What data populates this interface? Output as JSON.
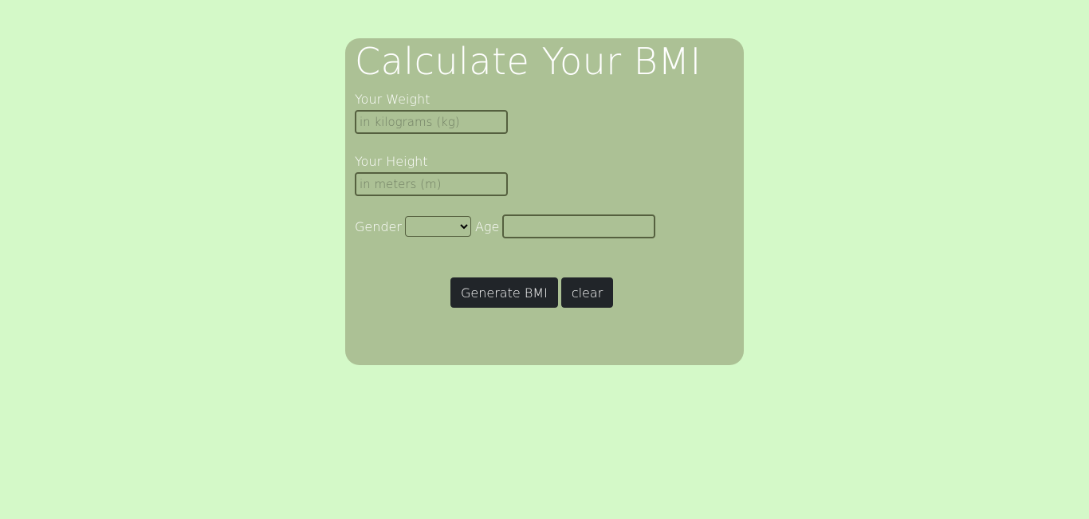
{
  "page": {
    "background": "#d4f9c8",
    "card_color": "#acc195",
    "button_color": "#212529"
  },
  "form": {
    "title": "Calculate Your BMI",
    "weight": {
      "label": "Your Weight",
      "placeholder": "in kilograms (kg)",
      "value": ""
    },
    "height": {
      "label": "Your Height",
      "placeholder": "in meters (m)",
      "value": ""
    },
    "gender": {
      "label": "Gender",
      "selected": ""
    },
    "age": {
      "label": "Age",
      "value": ""
    },
    "buttons": {
      "generate_label": "Generate BMI",
      "clear_label": "clear"
    }
  }
}
